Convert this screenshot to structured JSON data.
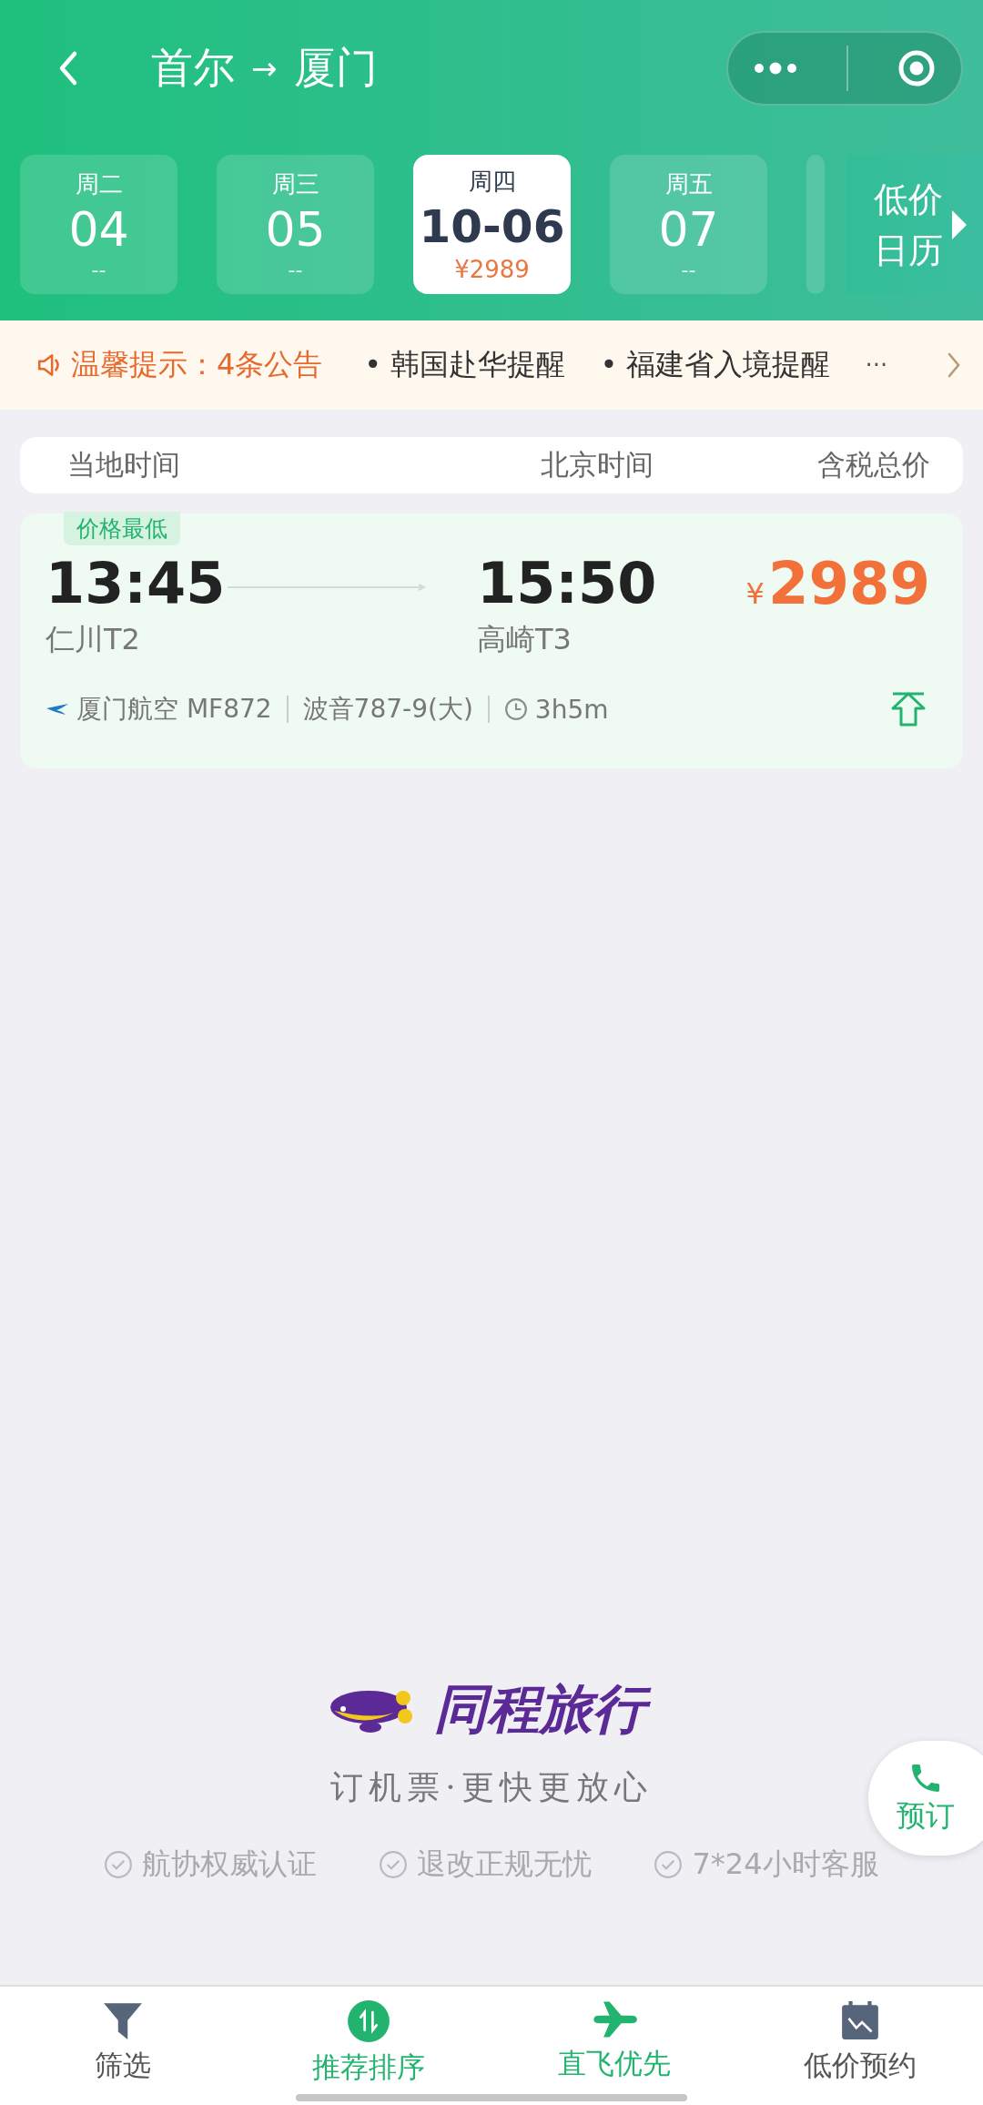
{
  "header": {
    "origin": "首尔",
    "arrow": "→",
    "destination": "厦门"
  },
  "dates": [
    {
      "weekday": "周二",
      "date": "04",
      "price": "--",
      "selected": false
    },
    {
      "weekday": "周三",
      "date": "05",
      "price": "--",
      "selected": false
    },
    {
      "weekday": "周四",
      "date": "10-06",
      "price": "¥2989",
      "selected": true
    },
    {
      "weekday": "周五",
      "date": "07",
      "price": "--",
      "selected": false
    }
  ],
  "calendar_button": {
    "line1": "低价",
    "line2": "日历"
  },
  "notice": {
    "title": "温馨提示：4条公告",
    "items": [
      "• 韩国赴华提醒",
      "• 福建省入境提醒"
    ],
    "more": "···"
  },
  "columns": [
    "当地时间",
    "北京时间",
    "含税总价"
  ],
  "flights": [
    {
      "tag": "价格最低",
      "depart_time": "13:45",
      "depart_airport": "仁川T2",
      "arrive_time": "15:50",
      "arrive_airport": "高崎T3",
      "currency": "¥",
      "price": "2989",
      "airline": "厦门航空 MF872",
      "aircraft": "波音787-9(大)",
      "duration": "3h5m"
    }
  ],
  "brand": {
    "name": "同程旅行",
    "slogan": "订机票·更快更放心"
  },
  "guarantees": [
    "航协权威认证",
    "退改正规无忧",
    "7*24小时客服"
  ],
  "float_button": "预订",
  "nav": [
    {
      "kind": "filter",
      "label": "筛选",
      "on": false
    },
    {
      "kind": "sort",
      "label": "推荐排序",
      "on": true
    },
    {
      "kind": "direct",
      "label": "直飞优先",
      "on": true
    },
    {
      "kind": "calendar",
      "label": "低价预约",
      "on": false
    }
  ]
}
